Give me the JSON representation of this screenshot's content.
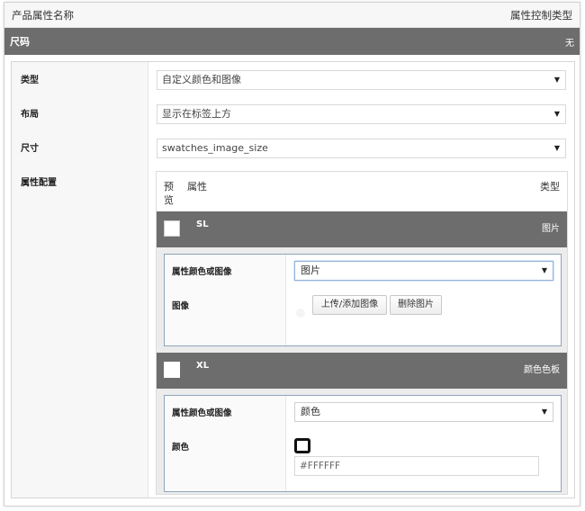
{
  "header": {
    "left_title": "产品属性名称",
    "right_title": "属性控制类型"
  },
  "attribute_bar": {
    "name": "尺码",
    "control_type": "无"
  },
  "fields": {
    "type": {
      "label": "类型",
      "value": "自定义颜色和图像"
    },
    "layout": {
      "label": "布局",
      "value": "显示在标签上方"
    },
    "size": {
      "label": "尺寸",
      "value": "swatches_image_size"
    },
    "config": {
      "label": "属性配置"
    }
  },
  "config_header": {
    "preview_line1": "预",
    "preview_line2": "览",
    "attribute": "属性",
    "type": "类型"
  },
  "terms": [
    {
      "name": "SL",
      "type": "图片",
      "attr_label": "属性颜色或图像",
      "attr_value": "图片",
      "image_label": "图像",
      "upload_label": "上传/添加图像",
      "remove_label": "删除图片"
    },
    {
      "name": "XL",
      "type": "颜色色板",
      "attr_label": "属性颜色或图像",
      "attr_value": "颜色",
      "color_label": "颜色",
      "color_value": "#FFFFFF"
    }
  ]
}
